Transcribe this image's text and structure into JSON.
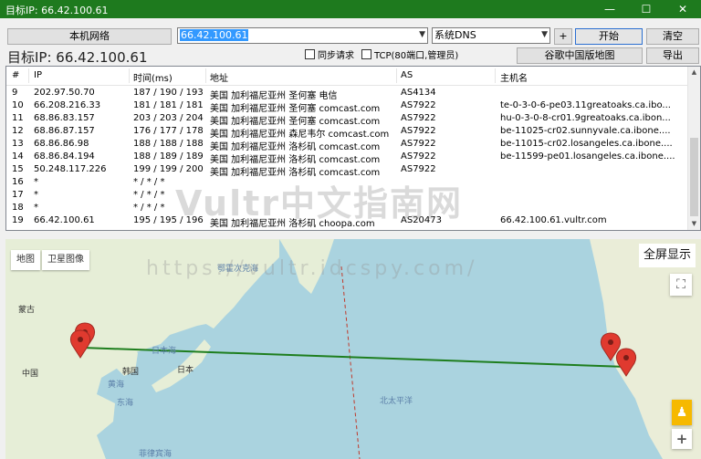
{
  "window": {
    "title": "目标IP: 66.42.100.61",
    "minimize": "—",
    "maximize": "☐",
    "close": "✕"
  },
  "toolbar": {
    "local_network_label": "本机网络",
    "ip_input_value": "66.42.100.61",
    "dns_select_value": "系统DNS",
    "plus_label": "+",
    "start_label": "开始",
    "clear_label": "清空",
    "target_ip_text": "目标IP:  66.42.100.61",
    "sync_request_label": "同步请求",
    "tcp_label": "TCP(80端口,管理员)",
    "google_map_label": "谷歌中国版地图",
    "export_label": "导出"
  },
  "table": {
    "headers": [
      "#",
      "IP",
      "时间(ms)",
      "地址",
      "AS",
      "主机名"
    ],
    "rows": [
      {
        "n": "9",
        "ip": "202.97.50.70",
        "time": "187 / 190 / 193",
        "addr": "美国 加利福尼亚州 圣何塞 电信",
        "as": "AS4134",
        "host": ""
      },
      {
        "n": "10",
        "ip": "66.208.216.33",
        "time": "181 / 181 / 181",
        "addr": "美国 加利福尼亚州 圣何塞 comcast.com",
        "as": "AS7922",
        "host": "te-0-3-0-6-pe03.11greatoaks.ca.ibo..."
      },
      {
        "n": "11",
        "ip": "68.86.83.157",
        "time": "203 / 203 / 204",
        "addr": "美国 加利福尼亚州 圣何塞 comcast.com",
        "as": "AS7922",
        "host": "hu-0-3-0-8-cr01.9greatoaks.ca.ibon..."
      },
      {
        "n": "12",
        "ip": "68.86.87.157",
        "time": "176 / 177 / 178",
        "addr": "美国 加利福尼亚州 森尼韦尔 comcast.com",
        "as": "AS7922",
        "host": "be-11025-cr02.sunnyvale.ca.ibone...."
      },
      {
        "n": "13",
        "ip": "68.86.86.98",
        "time": "188 / 188 / 188",
        "addr": "美国 加利福尼亚州 洛杉矶 comcast.com",
        "as": "AS7922",
        "host": "be-11015-cr02.losangeles.ca.ibone...."
      },
      {
        "n": "14",
        "ip": "68.86.84.194",
        "time": "188 / 189 / 189",
        "addr": "美国 加利福尼亚州 洛杉矶 comcast.com",
        "as": "AS7922",
        "host": "be-11599-pe01.losangeles.ca.ibone...."
      },
      {
        "n": "15",
        "ip": "50.248.117.226",
        "time": "199 / 199 / 200",
        "addr": "美国 加利福尼亚州 洛杉矶 comcast.com",
        "as": "AS7922",
        "host": ""
      },
      {
        "n": "16",
        "ip": "*",
        "time": "* / * / *",
        "addr": "",
        "as": "",
        "host": ""
      },
      {
        "n": "17",
        "ip": "*",
        "time": "* / * / *",
        "addr": "",
        "as": "",
        "host": ""
      },
      {
        "n": "18",
        "ip": "*",
        "time": "* / * / *",
        "addr": "",
        "as": "",
        "host": ""
      },
      {
        "n": "19",
        "ip": "66.42.100.61",
        "time": "195 / 195 / 196",
        "addr": "美国 加利福尼亚州 洛杉矶 choopa.com",
        "as": "AS20473",
        "host": "66.42.100.61.vultr.com"
      }
    ]
  },
  "map": {
    "tab_map": "地图",
    "tab_satellite": "卫星图像",
    "fullscreen": "全屏显示",
    "zoom_in": "+",
    "labels": {
      "mongolia": "蒙古",
      "china": "中国",
      "korea": "韩国",
      "japan": "日本",
      "sea_of_japan": "日本海",
      "yellow_sea": "黄海",
      "east_china_sea": "东海",
      "philippine_sea": "菲律宾海",
      "north_pacific": "北太平洋",
      "okhotsk": "鄂霍次克海"
    },
    "route_color": "#1e7e1e"
  },
  "watermark": {
    "main": "Vultr中文指南网",
    "url": "https://vultr.idcspy.com/"
  }
}
